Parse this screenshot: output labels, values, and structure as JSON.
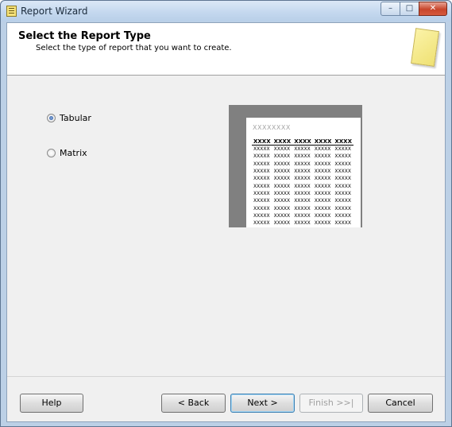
{
  "window": {
    "title": "Report Wizard",
    "controls": {
      "minimize": "–",
      "maximize": "□",
      "close": "✕"
    }
  },
  "header": {
    "title": "Select the Report Type",
    "subtitle": "Select the type of report that you want to create.",
    "icon": "note-icon"
  },
  "options": [
    {
      "label": "Tabular",
      "checked": true
    },
    {
      "label": "Matrix",
      "checked": false
    }
  ],
  "preview": {
    "title": "XXXXXXXX",
    "headers": [
      "XXXX",
      "XXXX",
      "XXXX",
      "XXXX",
      "XXXX"
    ],
    "rows": [
      [
        "XXXXX",
        "XXXXX",
        "XXXXX",
        "XXXXX",
        "XXXXX"
      ],
      [
        "XXXXX",
        "XXXXX",
        "XXXXX",
        "XXXXX",
        "XXXXX"
      ],
      [
        "XXXXX",
        "XXXXX",
        "XXXXX",
        "XXXXX",
        "XXXXX"
      ],
      [
        "XXXXX",
        "XXXXX",
        "XXXXX",
        "XXXXX",
        "XXXXX"
      ],
      [
        "XXXXX",
        "XXXXX",
        "XXXXX",
        "XXXXX",
        "XXXXX"
      ],
      [
        "XXXXX",
        "XXXXX",
        "XXXXX",
        "XXXXX",
        "XXXXX"
      ],
      [
        "XXXXX",
        "XXXXX",
        "XXXXX",
        "XXXXX",
        "XXXXX"
      ],
      [
        "XXXXX",
        "XXXXX",
        "XXXXX",
        "XXXXX",
        "XXXXX"
      ],
      [
        "XXXXX",
        "XXXXX",
        "XXXXX",
        "XXXXX",
        "XXXXX"
      ],
      [
        "XXXXX",
        "XXXXX",
        "XXXXX",
        "XXXXX",
        "XXXXX"
      ],
      [
        "XXXXX",
        "XXXXX",
        "XXXXX",
        "XXXXX",
        "XXXXX"
      ]
    ]
  },
  "buttons": {
    "help": "Help",
    "back": "< Back",
    "next": "Next >",
    "finish": "Finish >>|",
    "cancel": "Cancel"
  }
}
